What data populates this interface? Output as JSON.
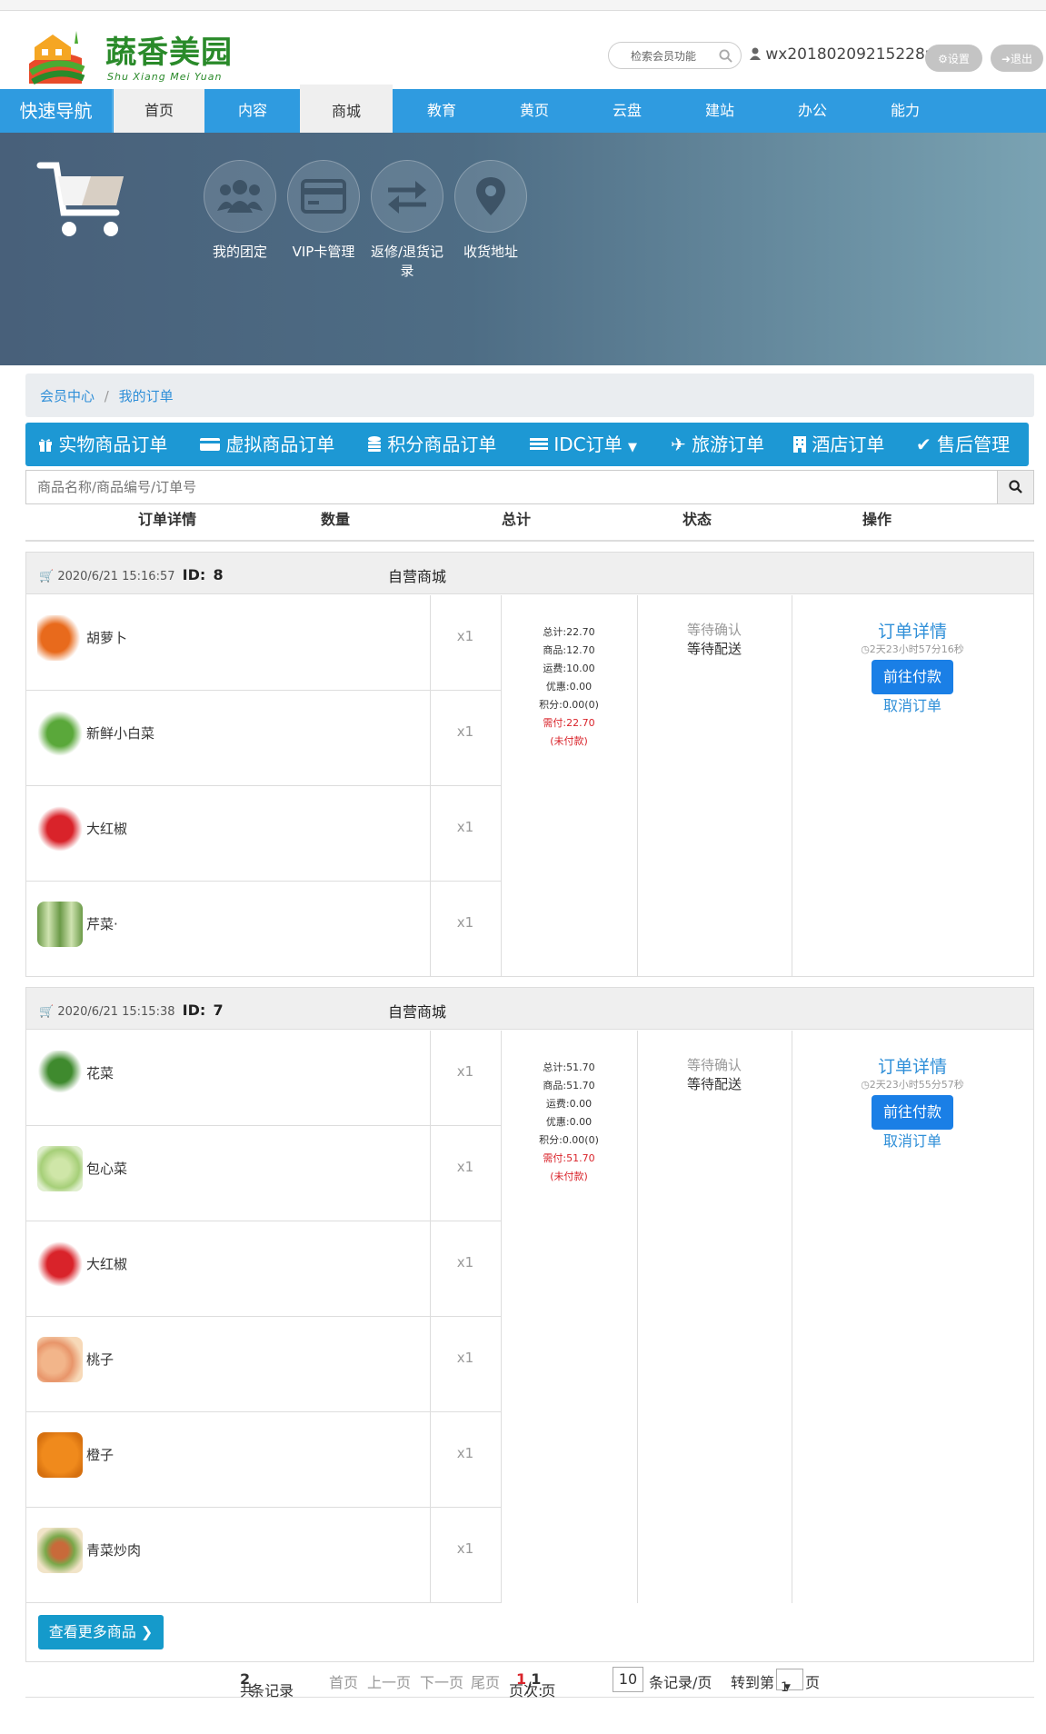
{
  "header": {
    "logo_title": "蔬香美园",
    "logo_subtitle": "Shu Xiang Mei Yuan",
    "search_placeholder": "检索会员功能",
    "username": "wx20180209215228r5",
    "settings_label": "设置",
    "logout_label": "退出"
  },
  "nav": {
    "quick": "快速导航",
    "items": [
      "首页",
      "内容",
      "商城",
      "教育",
      "黄页",
      "云盘",
      "建站",
      "办公",
      "能力"
    ],
    "active": "商城"
  },
  "banner": {
    "items": [
      {
        "label": "我的团定",
        "icon": "group-icon"
      },
      {
        "label": "VIP卡管理",
        "icon": "card-icon"
      },
      {
        "label": "返修/退货记录",
        "icon": "exchange-icon"
      },
      {
        "label": "收货地址",
        "icon": "location-icon"
      }
    ]
  },
  "breadcrumb": {
    "home": "会员中心",
    "sep": "/",
    "current": "我的订单"
  },
  "tabs": [
    {
      "label": "实物商品订单",
      "icon": "gift-icon"
    },
    {
      "label": "虚拟商品订单",
      "icon": "credit-card-icon"
    },
    {
      "label": "积分商品订单",
      "icon": "database-icon"
    },
    {
      "label": "IDC订单",
      "icon": "server-icon"
    },
    {
      "label": "旅游订单",
      "icon": "plane-icon"
    },
    {
      "label": "酒店订单",
      "icon": "building-icon"
    },
    {
      "label": "售后管理",
      "icon": "check-icon"
    }
  ],
  "order_search": {
    "placeholder": "商品名称/商品编号/订单号"
  },
  "columns": [
    "订单详情",
    "数量",
    "总计",
    "状态",
    "操作"
  ],
  "orders": [
    {
      "date": "2020/6/21 15:16:57",
      "id_label": "ID:",
      "id": "8",
      "shop": "自营商城",
      "items": [
        {
          "name": "胡萝卜",
          "qty": "x1",
          "color": "#e86a1c"
        },
        {
          "name": "新鲜小白菜",
          "qty": "x1",
          "color": "#5aa83a"
        },
        {
          "name": "大红椒",
          "qty": "x1",
          "color": "#d9232a"
        },
        {
          "name": "芹菜·",
          "qty": "x1",
          "color": "#6b9a48"
        }
      ],
      "summary": {
        "total": "总计:22.70",
        "goods": "商品:12.70",
        "shipping": "运费:10.00",
        "discount": "优惠:0.00",
        "points": "积分:0.00(0)",
        "payable": "需付:22.70",
        "unpaid": "(未付款)"
      },
      "status": {
        "line1": "等待确认",
        "line2": "等待配送"
      },
      "ops": {
        "detail": "订单详情",
        "timer": "2天23小时57分16秒",
        "pay": "前往付款",
        "cancel": "取消订单"
      }
    },
    {
      "date": "2020/6/21 15:15:38",
      "id_label": "ID:",
      "id": "7",
      "shop": "自营商城",
      "items": [
        {
          "name": "花菜",
          "qty": "x1",
          "color": "#3f8a2e"
        },
        {
          "name": "包心菜",
          "qty": "x1",
          "color": "#a6cf78"
        },
        {
          "name": "大红椒",
          "qty": "x1",
          "color": "#d9232a"
        },
        {
          "name": "桃子",
          "qty": "x1",
          "color": "#f2b58a"
        },
        {
          "name": "橙子",
          "qty": "x1",
          "color": "#f08a1c"
        },
        {
          "name": "青菜炒肉",
          "qty": "x1",
          "color": "#c86a3a"
        }
      ],
      "summary": {
        "total": "总计:51.70",
        "goods": "商品:51.70",
        "shipping": "运费:0.00",
        "discount": "优惠:0.00",
        "points": "积分:0.00(0)",
        "payable": "需付:51.70",
        "unpaid": "(未付款)"
      },
      "status": {
        "line1": "等待确认",
        "line2": "等待配送"
      },
      "ops": {
        "detail": "订单详情",
        "timer": "2天23小时55分57秒",
        "pay": "前往付款",
        "cancel": "取消订单"
      }
    }
  ],
  "more_button": "查看更多商品",
  "pager": {
    "total_prefix": "共",
    "total": "2",
    "total_suffix": "条记录",
    "first": "首页",
    "prev": "上一页",
    "next": "下一页",
    "last": "尾页",
    "page_label": "页次:",
    "current": "1",
    "slash": "/",
    "pages": "1",
    "page_suffix": "页",
    "per_page": "10",
    "per_page_suffix": "条记录/页",
    "goto_prefix": "转到第",
    "goto_value": "1",
    "goto_suffix": "页"
  },
  "colors": {
    "nav": "#2f9be0",
    "tabs": "#1d98d4",
    "link": "#2f8fd8",
    "pay": "#1a7fe6",
    "danger": "#d9232a"
  }
}
